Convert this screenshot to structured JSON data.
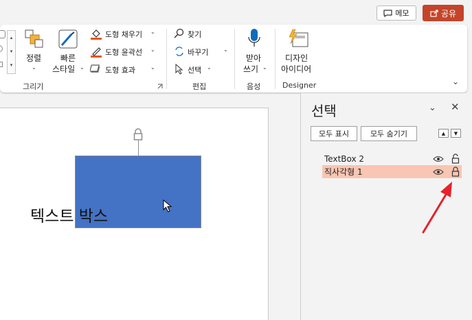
{
  "top": {
    "memo": "메모",
    "share": "공유"
  },
  "ribbon": {
    "arrange": "정렬",
    "quick_styles_1": "빠른",
    "quick_styles_2": "스타일",
    "shape_fill": "도형 채우기",
    "shape_outline": "도형 윤곽선",
    "shape_effects": "도형 효과",
    "find": "찾기",
    "replace": "바꾸기",
    "select": "선택",
    "dictate_1": "받아",
    "dictate_2": "쓰기",
    "designer_1": "디자인",
    "designer_2": "아이디어",
    "groups": {
      "drawing": "그리기",
      "editing": "편집",
      "voice": "음성",
      "designer": "Designer"
    },
    "colors": {
      "fill_bar": "#e8541c",
      "outline_bar": "#e8541c",
      "accent": "#0f6cbd"
    }
  },
  "slide": {
    "textbox_text": "텍스트 박스",
    "rect_color": "#4472c4"
  },
  "pane": {
    "title": "선택",
    "show_all": "모두 표시",
    "hide_all": "모두 숨기기",
    "items": [
      {
        "name": "TextBox 2",
        "selected": false,
        "locked": false
      },
      {
        "name": "직사각형 1",
        "selected": true,
        "locked": true
      }
    ],
    "annotation_color": "#e8212b"
  }
}
